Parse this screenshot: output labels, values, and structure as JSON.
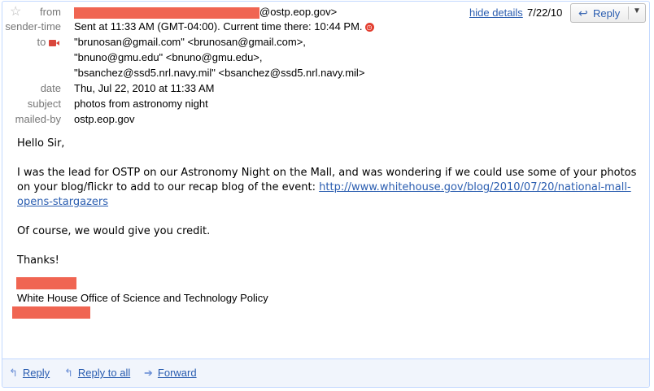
{
  "header": {
    "from_label": "from",
    "from_suffix": "@ostp.eop.gov>",
    "sender_time_label": "sender-time",
    "sender_time_value": "Sent at 11:33 AM (GMT-04:00). Current time there: 10:44 PM.",
    "to_label": "to",
    "to_lines": [
      "\"brunosan@gmail.com\" <brunosan@gmail.com>,",
      "\"bnuno@gmu.edu\" <bnuno@gmu.edu>,",
      "\"bsanchez@ssd5.nrl.navy.mil\" <bsanchez@ssd5.nrl.navy.mil>"
    ],
    "date_label": "date",
    "date_value": "Thu, Jul 22, 2010 at 11:33 AM",
    "subject_label": "subject",
    "subject_value": "photos from astronomy night",
    "mailed_by_label": "mailed-by",
    "mailed_by_value": "ostp.eop.gov",
    "hide_details": "hide details",
    "date_short": "7/22/10",
    "reply_button": "Reply"
  },
  "message": {
    "greeting": "Hello Sir,",
    "para1_text": "I was the lead for OSTP on our Astronomy Night on the Mall, and was wondering if we could use some of your photos on your blog/flickr to add to our recap blog of the event: ",
    "para1_link": "http://www.whitehouse.gov/blog/2010/07/20/national-mall-opens-stargazers",
    "para2": "Of course, we would give you credit.",
    "para3": "Thanks!",
    "signature_org": "White House Office of Science and Technology Policy"
  },
  "footer": {
    "reply": "Reply",
    "reply_all": "Reply to all",
    "forward": "Forward"
  },
  "colors": {
    "redaction": "#f06552",
    "link": "#2a5db0",
    "label": "#777777",
    "border": "#c3d9ff"
  }
}
